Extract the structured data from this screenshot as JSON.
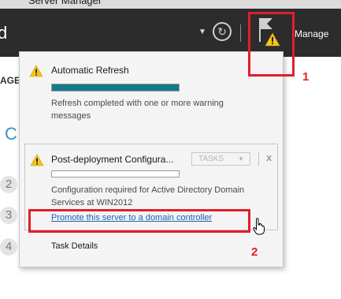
{
  "window": {
    "title": "Server Manager"
  },
  "header": {
    "breadcrumb_tail": "d",
    "manage_label": "Manage"
  },
  "background": {
    "left_section_label": "AGE",
    "left_heading_fragment": "C",
    "step_numbers": [
      "2",
      "3",
      "4"
    ]
  },
  "notifications": {
    "auto_refresh": {
      "title": "Automatic Refresh",
      "progress": 1.0,
      "message": "Refresh completed with one or more warning messages"
    },
    "post_deployment": {
      "title": "Post-deployment Configura...",
      "tasks_label": "TASKS",
      "close_glyph": "x",
      "progress": 0,
      "message": "Configuration required for Active Directory Domain Services at WIN2012",
      "link": "Promote this server to a domain controller"
    },
    "task_details_label": "Task Details"
  },
  "annotations": [
    {
      "number": "1",
      "target": "notifications-flag"
    },
    {
      "number": "2",
      "target": "promote-link"
    }
  ],
  "colors": {
    "title_bar": "#2c2c2c",
    "progress_fill": "#177a8a",
    "link": "#1a5fb4",
    "highlight": "#e01f2a",
    "warning": "#f5c518"
  },
  "icons": [
    "warning-icon",
    "refresh-icon",
    "flag-icon",
    "hand-cursor-icon"
  ]
}
